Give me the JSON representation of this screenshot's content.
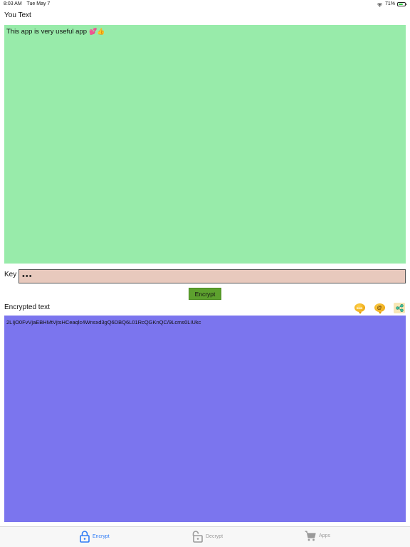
{
  "status_bar": {
    "time": "8:03 AM",
    "date": "Tue May 7",
    "battery_percent": "71%",
    "battery_level": 0.71,
    "icons": [
      "wifi-icon",
      "battery-icon"
    ]
  },
  "input": {
    "label": "You Text",
    "text": "This app is very useful app",
    "emoji": "💕👍"
  },
  "key": {
    "label": "Key",
    "masked_value": "•••"
  },
  "encrypt_button": {
    "label": "Encrypt"
  },
  "output": {
    "label": "Encrypted text",
    "text": "2LIjO0FvVjaEBHMtVjtsHCeaqlc4Wnsxd3gQ6DBQ6L01RcQGKnQC/9Lcms0LIUkc",
    "share_icons": [
      "sms-icon",
      "email-at-icon",
      "share-icon"
    ],
    "sms_label": "SMS"
  },
  "tab_bar": {
    "tabs": [
      {
        "label": "Encrypt",
        "icon": "lock-closed-icon",
        "active": true
      },
      {
        "label": "Decrypt",
        "icon": "lock-open-icon",
        "active": false
      },
      {
        "label": "Apps",
        "icon": "cart-icon",
        "active": false
      }
    ]
  },
  "colors": {
    "input_bg": "#98ebaa",
    "key_bg": "#e8c9bd",
    "button_bg": "#5da12e",
    "output_bg": "#7b75ee",
    "tab_active": "#2f7cf6",
    "tab_inactive": "#9a9a9a"
  }
}
